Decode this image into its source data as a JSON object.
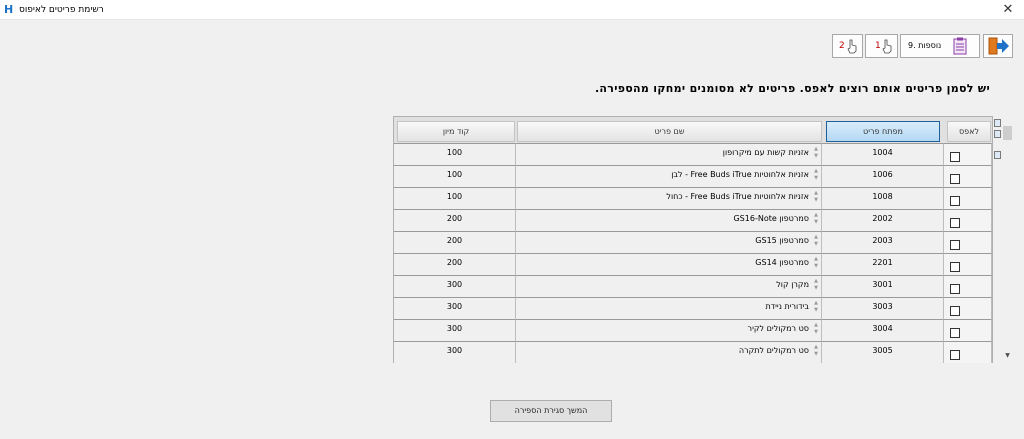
{
  "window": {
    "title": "רשימת פריטים לאיפוס",
    "app_icon_glyph": "H",
    "close_glyph": "✕"
  },
  "toolbar": {
    "extras_label": "9. נוספות",
    "one_label": "1",
    "two_label": "2"
  },
  "instruction": "יש לסמן פריטים אותם רוצים לאפס. פריטים לא מסומנים ימחקו מהספירה.",
  "table": {
    "columns": {
      "select": "לאפס",
      "key": "מפתח פריט",
      "name": "שם פריט",
      "code": "קוד מיון"
    },
    "rows": [
      {
        "key": "1004",
        "name": "אזניות קשות עם מיקרופון",
        "code": "100",
        "checked": false
      },
      {
        "key": "1006",
        "name": "אזניות אלחוטיות Free Buds iTrue - לבן",
        "code": "100",
        "checked": false
      },
      {
        "key": "1008",
        "name": "אזניות אלחוטיות Free Buds iTrue - כחול",
        "code": "100",
        "checked": false
      },
      {
        "key": "2002",
        "name": "סמרטפון GS16-Note",
        "code": "200",
        "checked": false
      },
      {
        "key": "2003",
        "name": "סמרטפון GS15",
        "code": "200",
        "checked": false
      },
      {
        "key": "2201",
        "name": "סמרטפון GS14",
        "code": "200",
        "checked": false
      },
      {
        "key": "3001",
        "name": "מקרן קול",
        "code": "300",
        "checked": false
      },
      {
        "key": "3003",
        "name": "בידורית ניידת",
        "code": "300",
        "checked": false
      },
      {
        "key": "3004",
        "name": "סט רמקולים לקיר",
        "code": "300",
        "checked": false
      },
      {
        "key": "3005",
        "name": "סט רמקולים לתקרה",
        "code": "300",
        "checked": false
      }
    ]
  },
  "continue_button": "המשך סגירת הספירה",
  "colors": {
    "header_selected": "#b4d8f3",
    "exit_arrow": "#1e73c8",
    "exit_door": "#e07a1f"
  }
}
